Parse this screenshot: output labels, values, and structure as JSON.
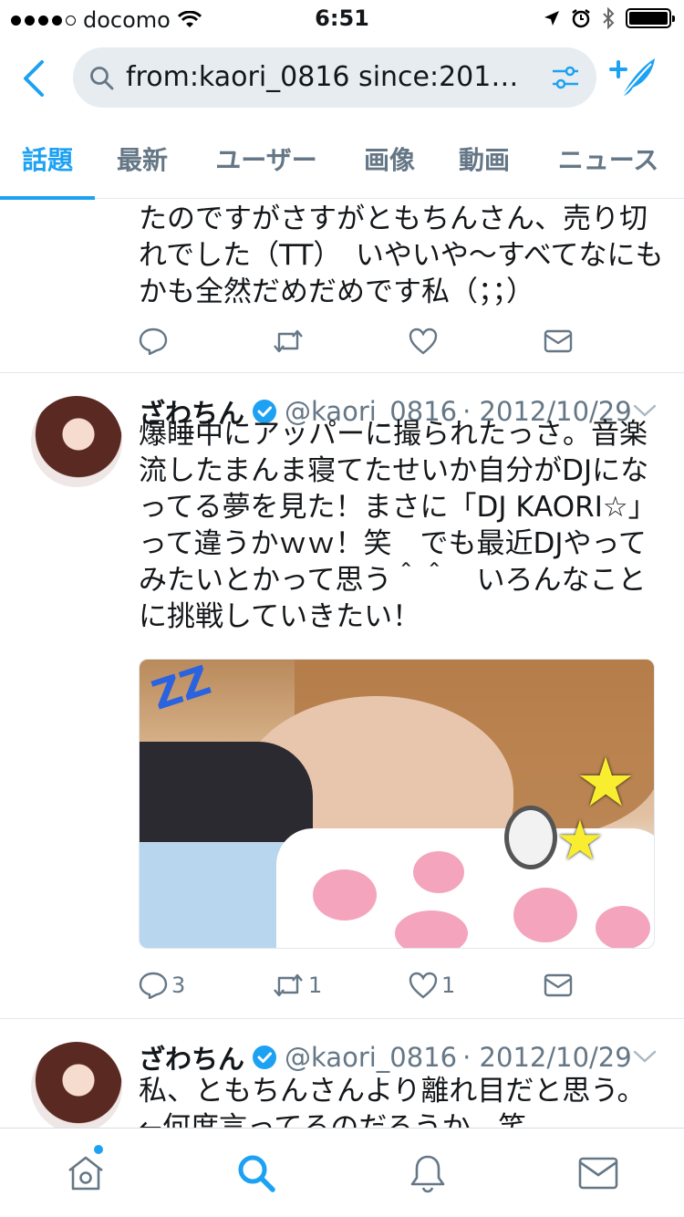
{
  "status_bar": {
    "carrier": "docomo",
    "time": "6:51"
  },
  "search": {
    "query": "from:kaori_0816 since:2012..."
  },
  "tabs": [
    {
      "label": "話題",
      "active": true
    },
    {
      "label": "最新",
      "active": false
    },
    {
      "label": "ユーザー",
      "active": false
    },
    {
      "label": "画像",
      "active": false
    },
    {
      "label": "動画",
      "active": false
    },
    {
      "label": "ニュース",
      "active": false
    }
  ],
  "tweets": [
    {
      "text": "たのですがさすがともちんさん、売り切れでした（TT）　いやいや〜すべてなにもかも全然だめだめです私（；；）"
    },
    {
      "name": "ざわちん",
      "handle": "@kaori_0816",
      "date": "· 2012/10/29",
      "text": "爆睡中にアッパーに撮られたっさ。音楽流したまんま寝てたせいか自分がDJになってる夢を見た！まさに「DJ KAORI☆」って違うかｗｗ！笑　でも最近DJやってみたいとかって思う＾＾　いろんなことに挑戦していきたい！",
      "replies": "3",
      "retweets": "1",
      "likes": "1"
    },
    {
      "name": "ざわちん",
      "handle": "@kaori_0816",
      "date": "· 2012/10/29",
      "text": "私、ともちんさんより離れ目だと思う。←何度言ってるのだろうか。笑"
    }
  ],
  "colors": {
    "accent": "#1da1f2",
    "muted": "#657786",
    "divider": "#e1e8ed"
  },
  "icons": {
    "home": "home-icon",
    "search": "search-icon",
    "notifications": "bell-icon",
    "messages": "envelope-icon"
  }
}
